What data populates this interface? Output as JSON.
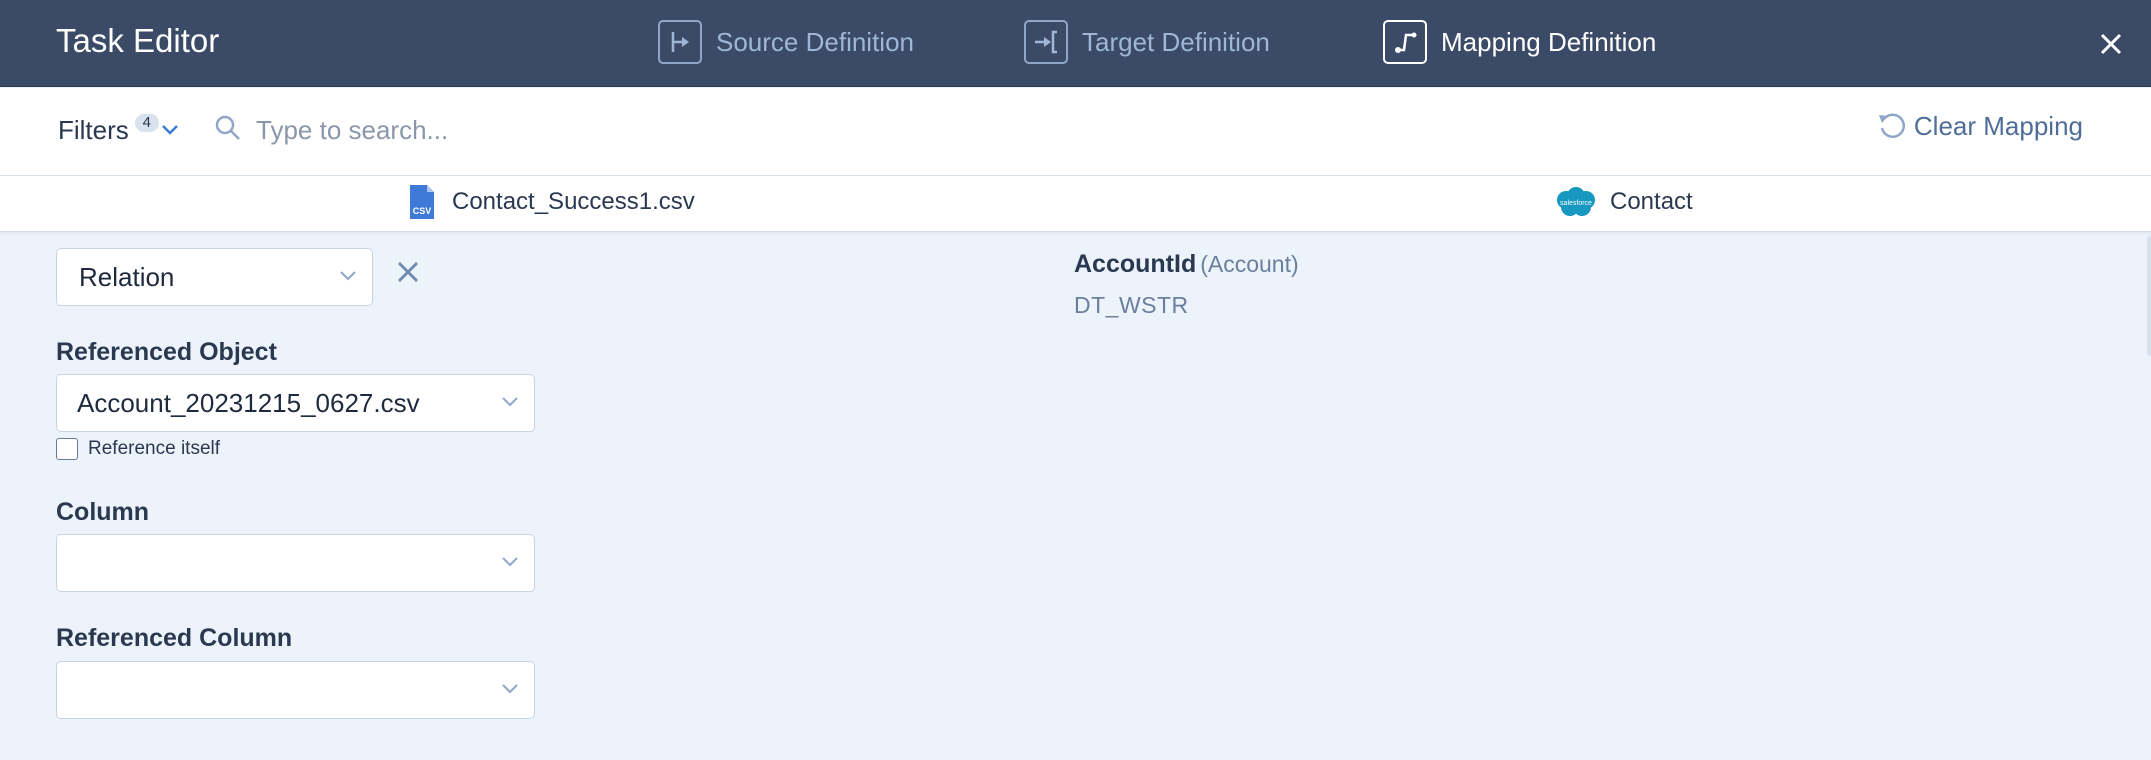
{
  "header": {
    "title": "Task Editor",
    "steps": [
      {
        "label": "Source Definition",
        "icon": "source-definition-icon"
      },
      {
        "label": "Target Definition",
        "icon": "target-definition-icon"
      },
      {
        "label": "Mapping Definition",
        "icon": "mapping-definition-icon",
        "active": true
      }
    ],
    "close_icon": "close-icon"
  },
  "toolbar": {
    "filters_label": "Filters",
    "filters_count": "4",
    "search_placeholder": "Type to search...",
    "search_value": "",
    "clear_mapping_label": "Clear Mapping"
  },
  "objects": {
    "source": {
      "name": "Contact_Success1.csv",
      "icon": "csv-file-icon",
      "icon_text": "CSV"
    },
    "target": {
      "name": "Contact",
      "icon": "salesforce-icon",
      "icon_text": "salesforce"
    }
  },
  "mapping": {
    "type_value": "Relation",
    "referenced_object_label": "Referenced Object",
    "referenced_object_value": "Account_20231215_0627.csv",
    "reference_itself_label": "Reference itself",
    "reference_itself_checked": false,
    "column_label": "Column",
    "column_value": "",
    "referenced_column_label": "Referenced Column",
    "referenced_column_value": ""
  },
  "target_field": {
    "name": "AccountId",
    "reference": "(Account)",
    "type": "DT_WSTR"
  },
  "colors": {
    "header_bg": "#3b4b67",
    "content_bg": "#edf3fb",
    "accent": "#4f6e97",
    "salesforce_blue": "#1798c1",
    "csv_blue": "#3f7ad8"
  }
}
